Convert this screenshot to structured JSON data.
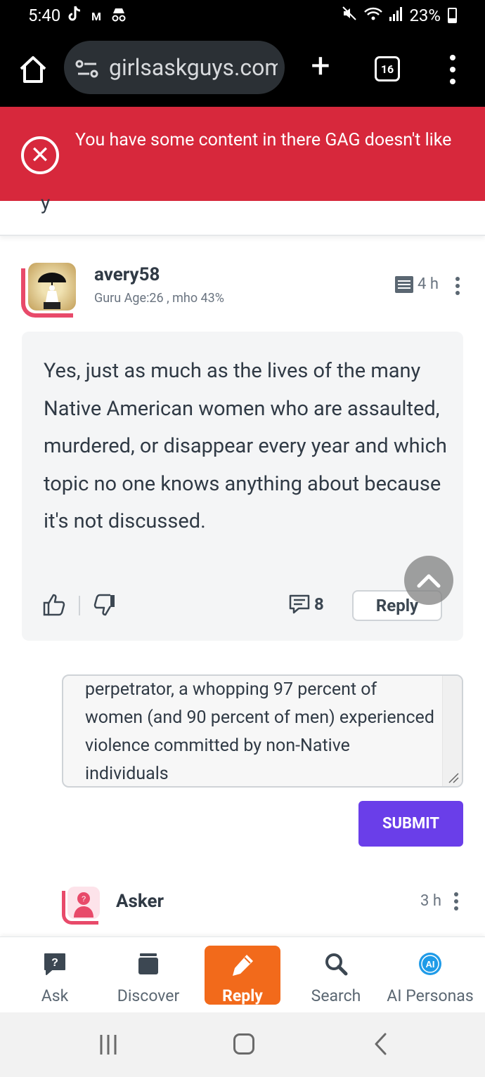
{
  "status_bar": {
    "time": "5:40",
    "battery": "23%"
  },
  "browser": {
    "url": "girlsaskguys.com",
    "tab_count": "16"
  },
  "error_banner": {
    "message": "You have some content in there GAG doesn't like"
  },
  "clipped_text": "y",
  "answer": {
    "username": "avery58",
    "user_info": "Guru Age:26 , mho 43%",
    "time": "4 h",
    "text": "Yes, just as much as the lives of the many Native American women who are assaulted, murdered, or disappear every year and which topic no one knows anything about because it's not discussed.",
    "comment_count": "8",
    "reply_label": "Reply"
  },
  "reply_box": {
    "text": "perpetrator, a whopping 97 percent of women (and 90 percent of men) experienced violence committed by non-Native individuals"
  },
  "submit_label": "SUBMIT",
  "asker": {
    "label": "Asker",
    "time": "3 h"
  },
  "bottom_nav": {
    "ask": "Ask",
    "discover": "Discover",
    "reply": "Reply",
    "search": "Search",
    "ai_personas": "AI Personas"
  }
}
